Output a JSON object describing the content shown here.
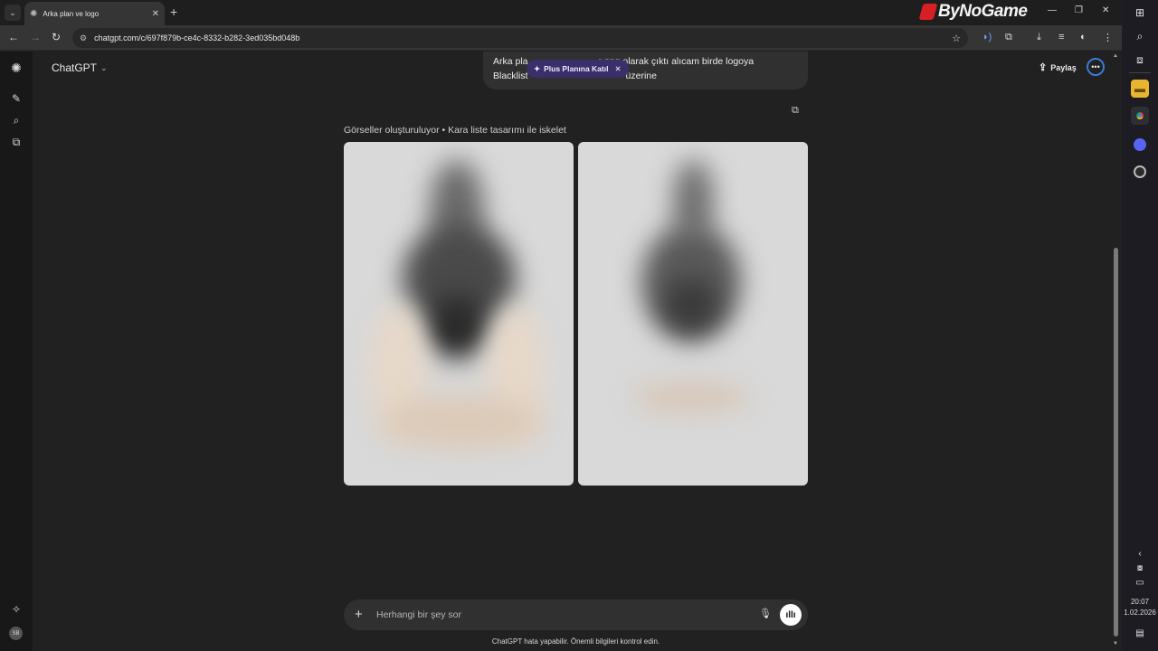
{
  "browser": {
    "tab_title": "Arka plan ve logo",
    "url": "chatgpt.com/c/697f879b-ce4c-8332-b282-3ed035bd048b",
    "brand_overlay": "ByNoGame"
  },
  "app": {
    "model_name": "ChatGPT",
    "share_label": "Paylaş",
    "avatar_initials": "SB"
  },
  "conversation": {
    "user_message": "Arka plan şeffaf olsun bir png olarak çıktı alıcam birde logoya Blacklist yazısı ekle kafanın üzerine",
    "user_message_visible_line1": "Arka pla",
    "user_message_visible_line1_end": "r png olarak çıktı alıcam birde logoya",
    "user_message_visible_line2": "Blacklist",
    "user_message_visible_line2_end": "üzerine",
    "upsell_pill": "Plus Planına Katıl",
    "generation_status": "Görseller oluşturuluyor • Kara liste tasarımı ile iskelet"
  },
  "composer": {
    "placeholder": "Herhangi bir şey sor"
  },
  "footer": {
    "disclaimer": "ChatGPT hata yapabilir. Önemli bilgileri kontrol edin."
  },
  "system": {
    "time": "20:07",
    "date": "1.02.2026"
  },
  "colors": {
    "background": "#212121",
    "bubble": "#303030",
    "upsell_pill": "#3b2f6b",
    "accent_ring": "#3a7bd5"
  }
}
